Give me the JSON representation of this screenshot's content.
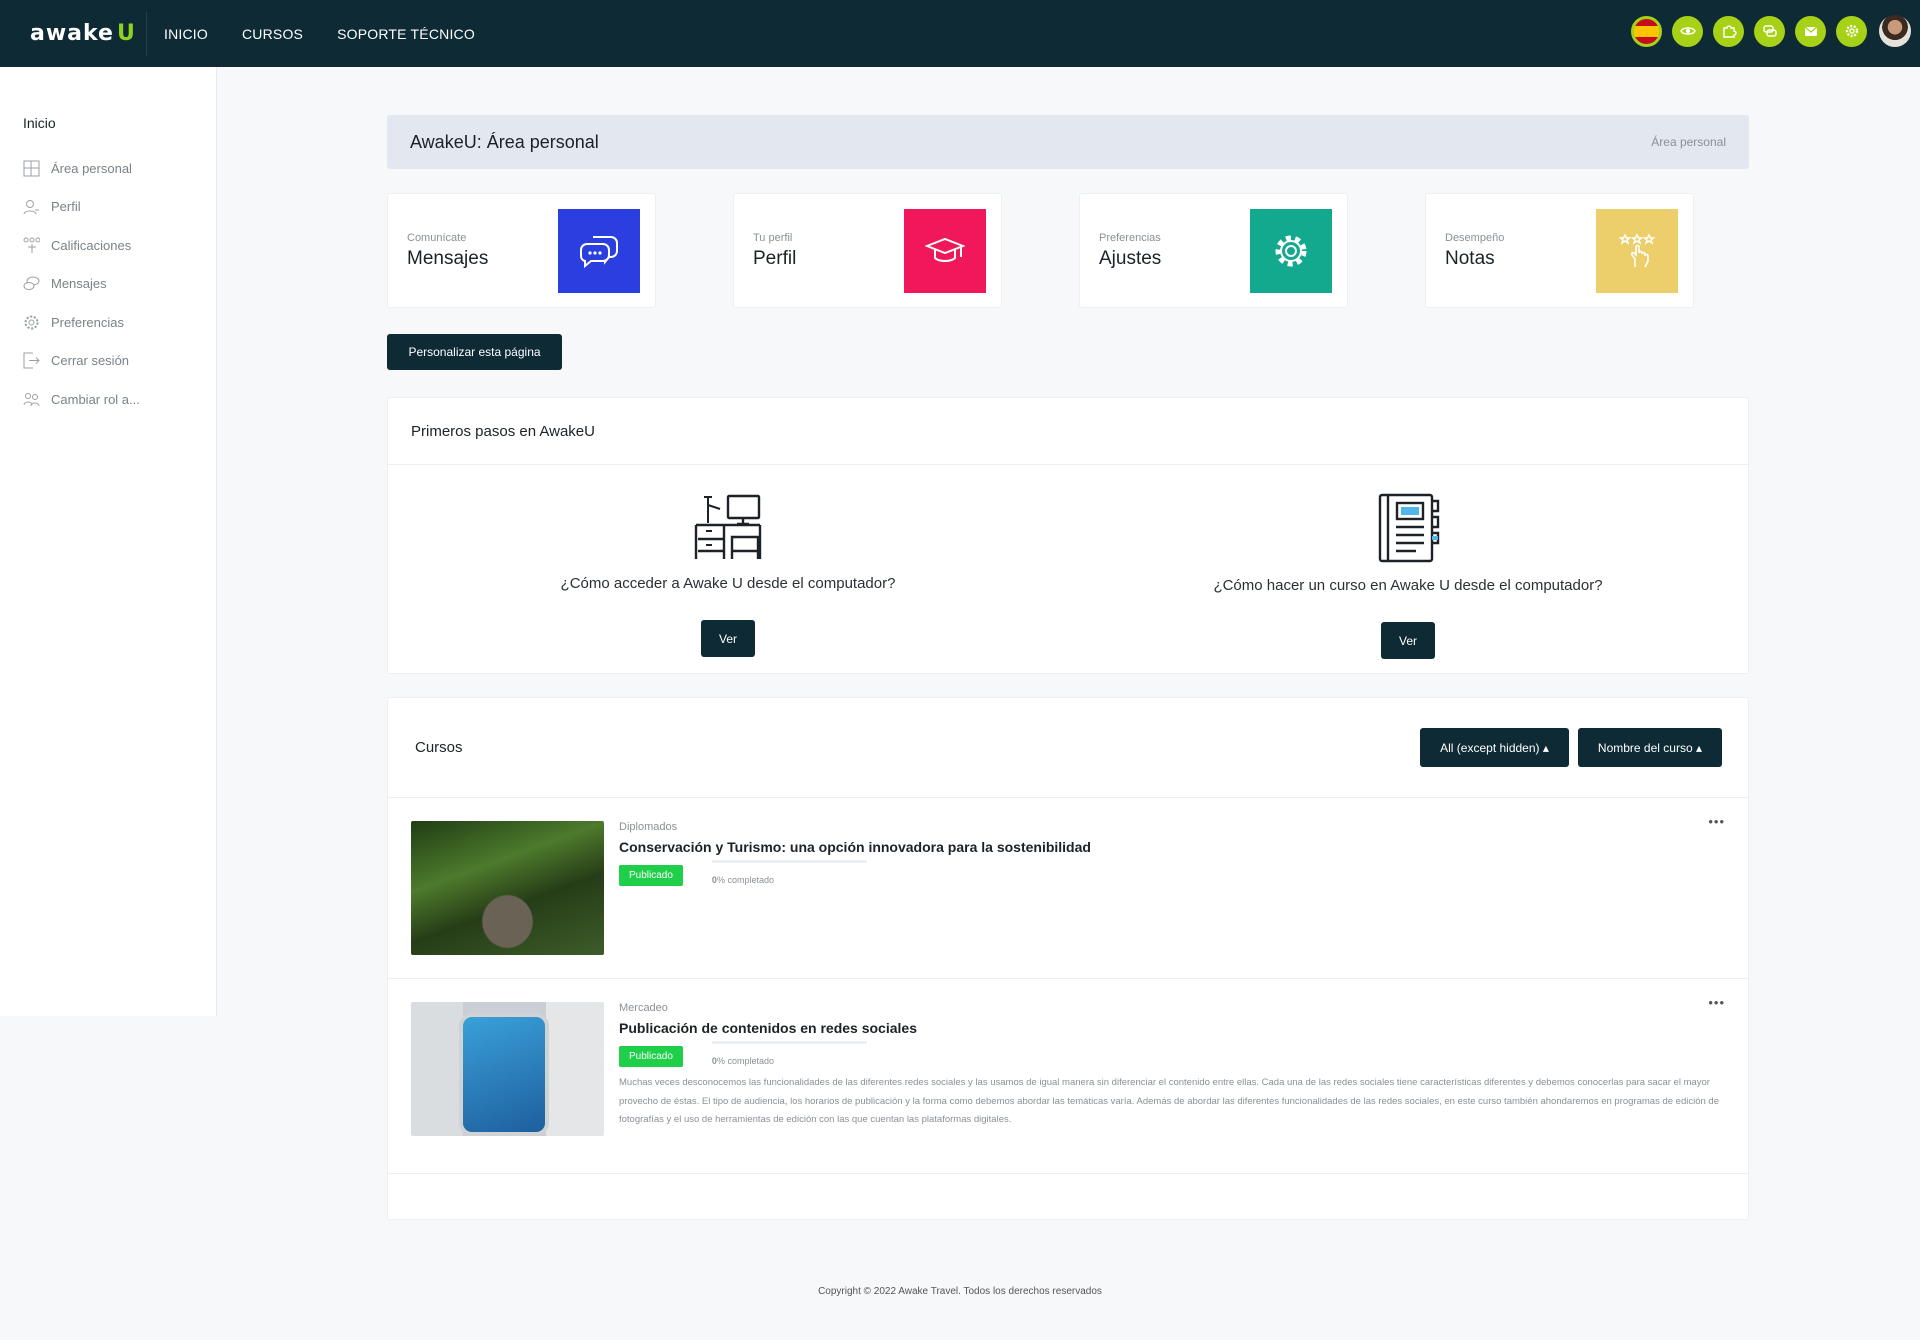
{
  "brand": {
    "logo_main": "awake",
    "logo_accent": "U"
  },
  "topnav": [
    "INICIO",
    "CURSOS",
    "SOPORTE TÉCNICO"
  ],
  "topbar_icons": [
    "spain-flag-icon",
    "eye-icon",
    "puzzle-icon",
    "chat-icon",
    "mail-icon",
    "gear-icon"
  ],
  "sidebar": {
    "title": "Inicio",
    "items": [
      {
        "label": "Área personal",
        "icon": "dashboard-icon"
      },
      {
        "label": "Perfil",
        "icon": "profile-icon"
      },
      {
        "label": "Calificaciones",
        "icon": "grades-icon"
      },
      {
        "label": "Mensajes",
        "icon": "messages-icon"
      },
      {
        "label": "Preferencias",
        "icon": "gear-icon"
      },
      {
        "label": "Cerrar sesión",
        "icon": "logout-icon"
      },
      {
        "label": "Cambiar rol a...",
        "icon": "users-icon"
      }
    ]
  },
  "header": {
    "title": "AwakeU: Área personal",
    "breadcrumb": "Área personal"
  },
  "cards": [
    {
      "sub": "Comunícate",
      "title": "Mensajes",
      "color": "#2b3fe0",
      "icon": "chat-bubbles-icon"
    },
    {
      "sub": "Tu perfil",
      "title": "Perfil",
      "color": "#f0185a",
      "icon": "graduation-cap-icon"
    },
    {
      "sub": "Preferencias",
      "title": "Ajustes",
      "color": "#13a98f",
      "icon": "gear-icon"
    },
    {
      "sub": "Desempeño",
      "title": "Notas",
      "color": "#ecce6b",
      "icon": "stars-hand-icon"
    }
  ],
  "customize_button": "Personalizar esta página",
  "pasos": {
    "title": "Primeros pasos en AwakeU",
    "steps": [
      {
        "question": "¿Cómo acceder a Awake U desde el computador?",
        "button": "Ver",
        "icon": "computer-desk-icon"
      },
      {
        "question": "¿Cómo hacer un curso en Awake U desde el computador?",
        "button": "Ver",
        "icon": "notebook-icon"
      }
    ]
  },
  "cursos": {
    "title": "Cursos",
    "filter": "All (except hidden)",
    "sort": "Nombre del curso",
    "items": [
      {
        "category": "Diplomados",
        "name": "Conservación y Turismo: una opción innovadora para la sostenibilidad",
        "status": "Publicado",
        "progress_pct": "0",
        "progress_label": "% completado",
        "progress_value": 0,
        "description": ""
      },
      {
        "category": "Mercadeo",
        "name": "Publicación de contenidos en redes sociales",
        "status": "Publicado",
        "progress_pct": "0",
        "progress_label": "% completado",
        "progress_value": 0,
        "description": "Muchas veces desconocemos las funcionalidades de las diferentes redes sociales y las usamos de igual manera sin diferenciar el contenido entre ellas. Cada una de las redes sociales tiene características diferentes y debemos conocerlas para sacar el mayor provecho de éstas. El tipo de audiencia, los horarios de publicación y la forma como debemos abordar las temáticas varía. Además de abordar las diferentes funcionalidades de las redes sociales, en este curso también ahondaremos en programas de edición de fotografías y el uso de herramientas de edición con las que cuentan las plataformas digitales."
      }
    ]
  },
  "footer": "Copyright © 2022 Awake Travel. Todos los derechos reservados"
}
